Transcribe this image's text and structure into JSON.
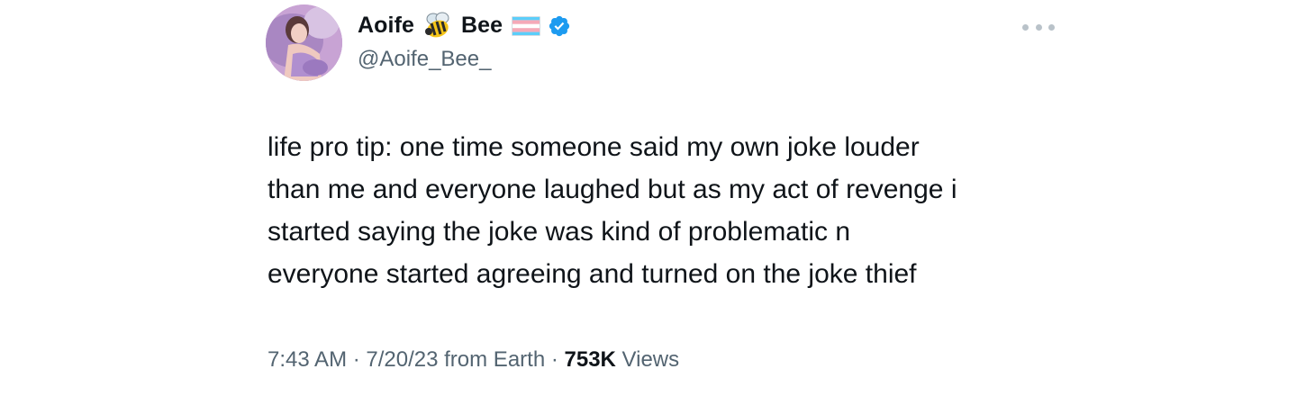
{
  "author": {
    "name_first": "Aoife",
    "name_second": "Bee",
    "handle": "@Aoife_Bee_",
    "emoji": [
      "bee-icon",
      "transgender-flag-icon"
    ],
    "verified": true
  },
  "tweet": {
    "lines": [
      "life pro tip: one time someone said my own joke louder",
      "than me and everyone laughed but as my act of revenge i",
      "started saying the joke was kind of problematic n",
      "everyone started agreeing and turned on the joke thief"
    ]
  },
  "meta": {
    "time": "7:43 AM",
    "sep1": " · ",
    "date": "7/20/23",
    "source": " from Earth",
    "sep2": " · ",
    "views_count": "753K",
    "views_label": " Views"
  },
  "colors": {
    "text": "#0f1419",
    "secondary": "#536471",
    "verified": "#1d9bf0",
    "flag_blue": "#5bcefa",
    "flag_pink": "#f5a9b8",
    "flag_white": "#ffffff"
  }
}
